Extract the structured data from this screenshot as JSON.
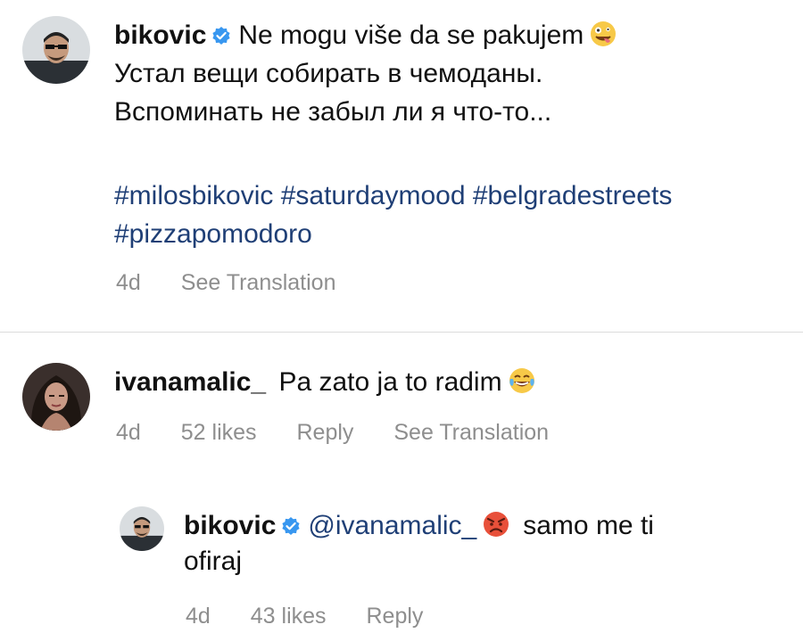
{
  "post": {
    "username": "bikovic",
    "caption_line1": "Ne mogu više da se pakujem",
    "caption_line2": "Устал вещи собирать в чемоданы.",
    "caption_line3": "Вспоминать не забыл ли я что-то...",
    "hashtags_line1": "#milosbikovic #saturdaymood #belgradestreets",
    "hashtags_line2": "#pizzapomodoro",
    "time": "4d",
    "see_translation": "See Translation",
    "emoji": "zany-face-emoji"
  },
  "comment": {
    "username": "ivanamalic_",
    "text": "Pa zato ja to radim",
    "time": "4d",
    "likes": "52 likes",
    "reply": "Reply",
    "see_translation": "See Translation",
    "emoji": "tears-of-joy-emoji"
  },
  "reply": {
    "username": "bikovic",
    "mention": "@ivanamalic_",
    "text_after": "samo me ti",
    "text_line2": "ofiraj",
    "time": "4d",
    "likes": "43 likes",
    "reply": "Reply",
    "emoji": "angry-face-emoji"
  },
  "colors": {
    "verified_blue": "#3897f0",
    "meta_gray": "#8e8e8e",
    "hashtag_blue": "#1f3f76"
  }
}
